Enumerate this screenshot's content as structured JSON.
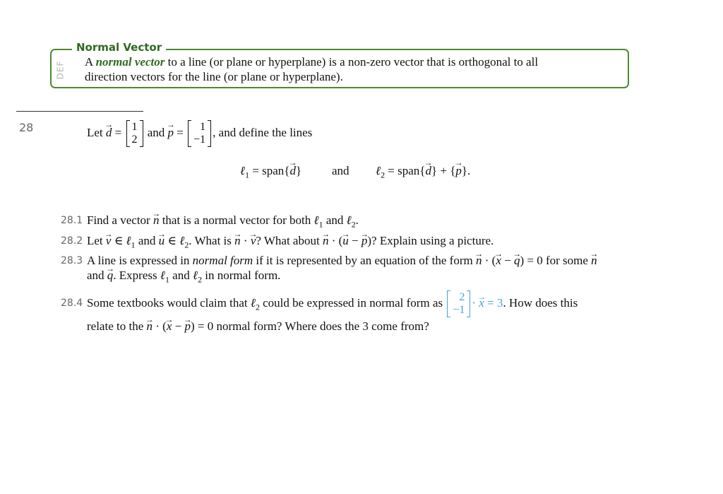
{
  "definition": {
    "tag": "DEF",
    "title": "Normal Vector",
    "article": "A",
    "term": "normal vector",
    "body_line1_rest": "to a line (or plane or hyperplane) is a non-zero vector that is orthogonal to all",
    "body_line2": "direction vectors for the line (or plane or hyperplane).",
    "accent_color": "#4b8a32"
  },
  "problem": {
    "number": "28",
    "intro": {
      "let": "Let",
      "d_name": "d",
      "d_vector": [
        "1",
        "2"
      ],
      "and": "and",
      "p_name": "p",
      "p_vector": [
        "1",
        "−1"
      ],
      "tail": ", and define the lines"
    },
    "lines": {
      "l1_lhs": "ℓ",
      "l1_sub": "1",
      "l1_rhs_pre": " = span{",
      "l1_rhs_vec": "d",
      "l1_rhs_post": "}",
      "connector": "and",
      "l2_lhs": "ℓ",
      "l2_sub": "2",
      "l2_rhs_pre": " = span{",
      "l2_rhs_vec": "d",
      "l2_rhs_mid": "} + {",
      "l2_rhs_vec2": "p",
      "l2_rhs_post": "}."
    },
    "items": [
      {
        "number": "28.1",
        "text_a": "Find a vector",
        "text_b": "that is a normal vector for both",
        "text_c": "and",
        "text_d": "."
      },
      {
        "number": "28.2",
        "text_a": "Let",
        "text_b": "and",
        "text_c": ". What is",
        "text_d": "? What about",
        "text_e": "? Explain using a picture."
      },
      {
        "number": "28.3",
        "text_a": "A line is expressed in",
        "emph": "normal form",
        "text_b": "if it is represented by an equation of the form",
        "text_c": "= 0 for some",
        "line2_a": "and",
        "line2_b": ". Express",
        "line2_c": "and",
        "line2_d": "in normal form."
      },
      {
        "number": "28.4",
        "text_a": "Some textbooks would claim that",
        "text_b": "could be expressed in normal form as",
        "vector": [
          "2",
          "−1"
        ],
        "eq_tail": "= 3",
        "text_c": ". How does this",
        "line2_a": "relate to the",
        "line2_b": "= 0 normal form? Where does the 3 come from?",
        "highlight_color": "#4a9fd8"
      }
    ]
  }
}
